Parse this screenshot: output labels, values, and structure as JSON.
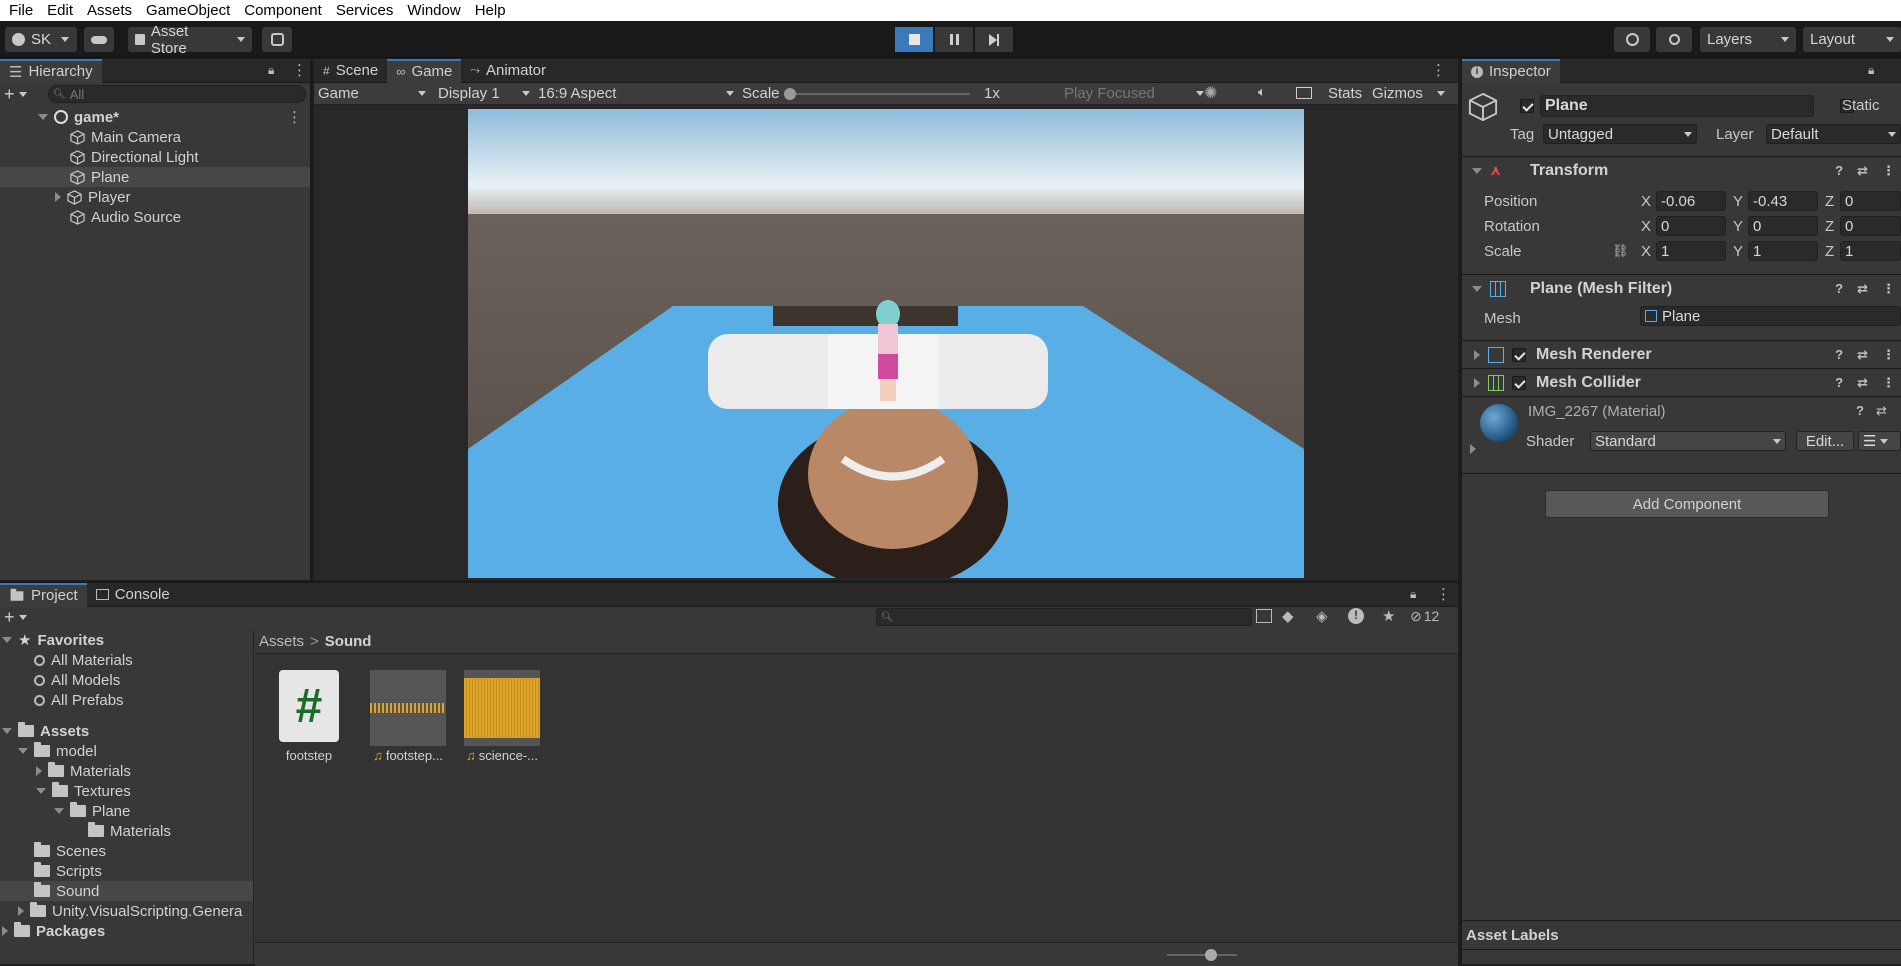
{
  "menu": [
    "File",
    "Edit",
    "Assets",
    "GameObject",
    "Component",
    "Services",
    "Window",
    "Help"
  ],
  "toolbar": {
    "account": "SK",
    "asset_store": "Asset Store",
    "layers": "Layers",
    "layout": "Layout"
  },
  "hierarchy": {
    "tab": "Hierarchy",
    "search_placeholder": "All",
    "scene": "game*",
    "items": [
      "Main Camera",
      "Directional Light",
      "Plane",
      "Player",
      "Audio Source"
    ]
  },
  "game_view": {
    "tabs": [
      "Scene",
      "Game",
      "Animator"
    ],
    "mode": "Game",
    "display": "Display 1",
    "aspect": "16:9 Aspect",
    "scale_label": "Scale",
    "scale_value": "1x",
    "play_focus": "Play Focused",
    "stats": "Stats",
    "gizmos": "Gizmos"
  },
  "project": {
    "tabs": [
      "Project",
      "Console"
    ],
    "hidden_count": "12",
    "favorites_label": "Favorites",
    "favorites": [
      "All Materials",
      "All Models",
      "All Prefabs"
    ],
    "assets_label": "Assets",
    "tree": {
      "model": "model",
      "materials": "Materials",
      "textures": "Textures",
      "plane": "Plane",
      "plane_materials": "Materials",
      "scenes": "Scenes",
      "scripts": "Scripts",
      "sound": "Sound",
      "unity_vs": "Unity.VisualScripting.Genera"
    },
    "packages_label": "Packages",
    "breadcrumb_root": "Assets",
    "breadcrumb_sep": ">",
    "breadcrumb_current": "Sound",
    "files": [
      "footstep",
      "footstep...",
      "science-..."
    ]
  },
  "inspector": {
    "tab": "Inspector",
    "object_name": "Plane",
    "static_label": "Static",
    "tag_label": "Tag",
    "tag_value": "Untagged",
    "layer_label": "Layer",
    "layer_value": "Default",
    "transform": {
      "title": "Transform",
      "position_label": "Position",
      "rotation_label": "Rotation",
      "scale_label": "Scale",
      "position": [
        "-0.06",
        "-0.43",
        "0"
      ],
      "rotation": [
        "0",
        "0",
        "0"
      ],
      "scale": [
        "1",
        "1",
        "1"
      ],
      "axes": [
        "X",
        "Y",
        "Z"
      ]
    },
    "mesh_filter": {
      "title": "Plane (Mesh Filter)",
      "mesh_label": "Mesh",
      "mesh_value": "Plane"
    },
    "mesh_renderer": "Mesh Renderer",
    "mesh_collider": "Mesh Collider",
    "material": {
      "title": "IMG_2267 (Material)",
      "shader_label": "Shader",
      "shader_value": "Standard",
      "edit": "Edit..."
    },
    "add_component": "Add Component",
    "asset_labels": "Asset Labels"
  },
  "colors": {
    "accent": "#3a79bb",
    "plane": "#5aaee6",
    "panel": "#383838"
  }
}
